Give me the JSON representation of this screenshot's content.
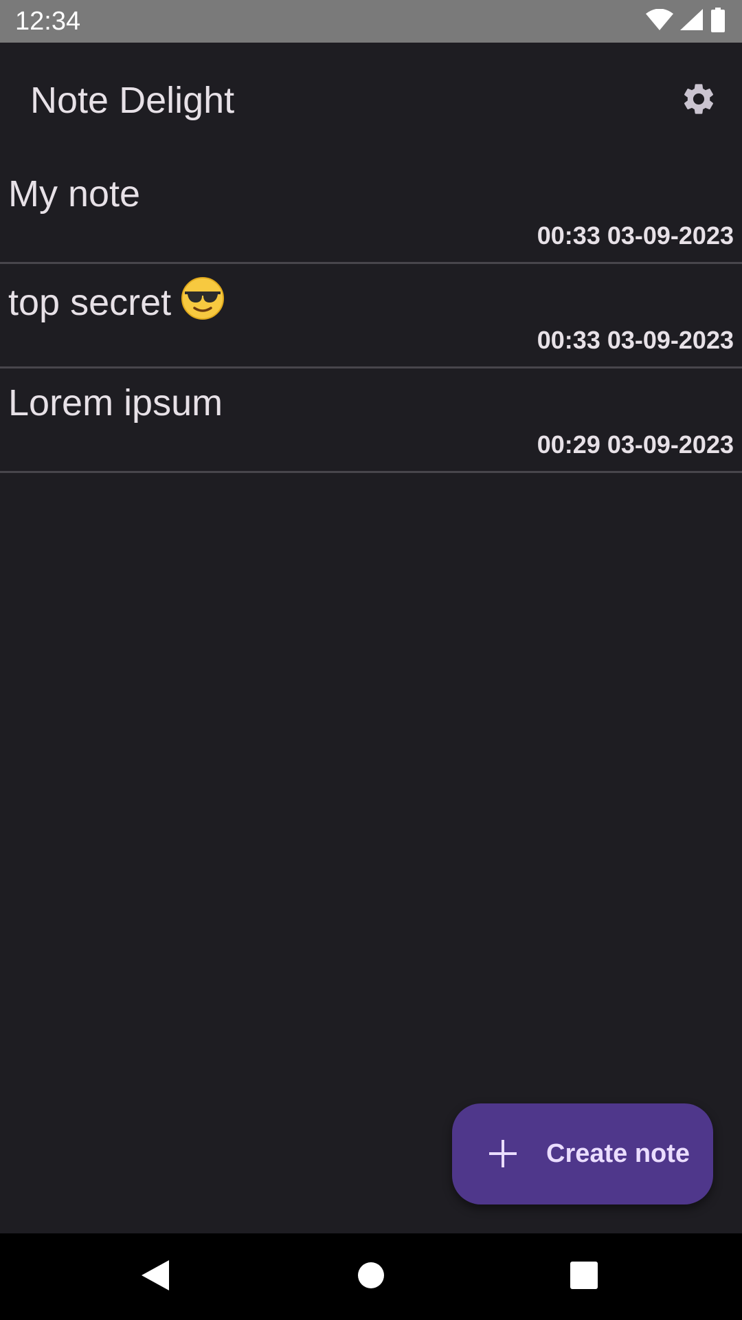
{
  "status_bar": {
    "time": "12:34",
    "icons": [
      "wifi-icon",
      "cellular-signal-icon",
      "battery-icon"
    ]
  },
  "app_bar": {
    "title": "Note Delight",
    "settings_icon": "gear-icon"
  },
  "notes": [
    {
      "title": "My note",
      "emoji": "",
      "datetime": "00:33 03-09-2023"
    },
    {
      "title": "top secret",
      "emoji": "smiling-face-with-sunglasses",
      "datetime": "00:33 03-09-2023"
    },
    {
      "title": "Lorem ipsum",
      "emoji": "",
      "datetime": "00:29 03-09-2023"
    }
  ],
  "fab": {
    "icon": "plus-icon",
    "label": "Create note"
  },
  "nav_bar": {
    "buttons": [
      "back-icon",
      "home-icon",
      "recents-icon"
    ]
  },
  "colors": {
    "background": "#1e1d22",
    "status_bar": "#7a7a7a",
    "text": "#e7e1e7",
    "divider": "#48464c",
    "fab_background": "#4f378b",
    "fab_text": "#eaddff",
    "nav_bar": "#000000"
  }
}
